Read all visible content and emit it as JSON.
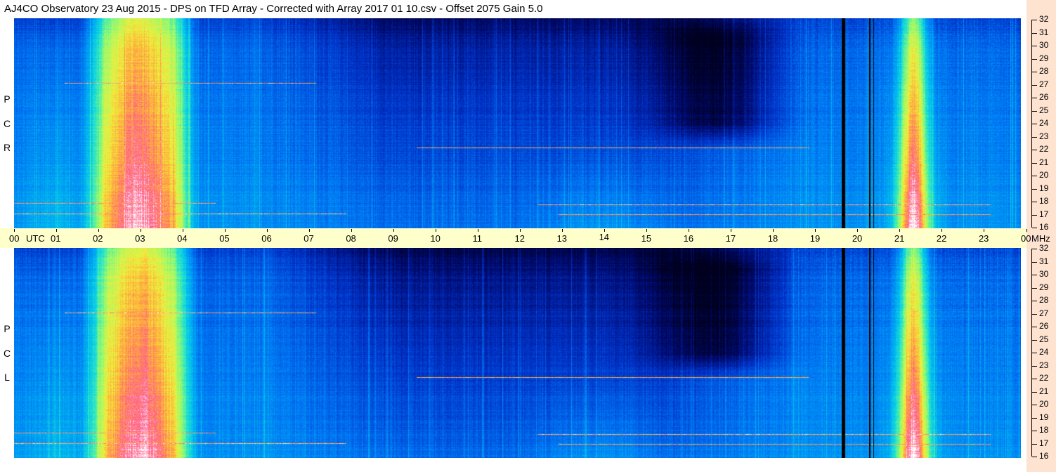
{
  "title": "AJ4CO Observatory  23 Aug 2015  -  DPS on TFD Array  -  Corrected with Array 2017 01 10.csv  -  Offset 2075  Gain 5.0",
  "panels": [
    {
      "id": "top",
      "label": [
        "R",
        "C",
        "P"
      ]
    },
    {
      "id": "bottom",
      "label": [
        "L",
        "C",
        "P"
      ]
    }
  ],
  "time_axis": {
    "ticks": [
      "00",
      "01",
      "02",
      "03",
      "04",
      "05",
      "06",
      "07",
      "08",
      "09",
      "10",
      "11",
      "12",
      "13",
      "14",
      "15",
      "16",
      "17",
      "18",
      "19",
      "20",
      "21",
      "22",
      "23",
      "00"
    ],
    "utc_label": "UTC",
    "unit": "MHz"
  },
  "freq_axis": {
    "ticks": [
      "32",
      "31",
      "30",
      "29",
      "28",
      "27",
      "26",
      "25",
      "24",
      "23",
      "22",
      "21",
      "20",
      "19",
      "18",
      "17",
      "16"
    ]
  },
  "chart_data": {
    "type": "heatmap",
    "title": "AJ4CO Observatory  23 Aug 2015  -  DPS on TFD Array  -  Corrected with Array 2017 01 10.csv  -  Offset 2075  Gain 5.0",
    "xlabel": "UTC",
    "ylabel": "MHz",
    "xlim": [
      0,
      24
    ],
    "ylim": [
      16,
      32
    ],
    "series": [
      {
        "name": "RCP"
      },
      {
        "name": "LCP"
      }
    ],
    "features": {
      "broad_bright_bands_hours": [
        [
          1.9,
          4.2
        ],
        [
          21.2,
          21.8
        ]
      ],
      "dark_region_hours": [
        15.5,
        18.0
      ],
      "vertical_black_lines_hours": [
        19.75,
        20.4
      ],
      "horizontal_interference_mhz": [
        17.2,
        18.0,
        27.1
      ]
    }
  }
}
